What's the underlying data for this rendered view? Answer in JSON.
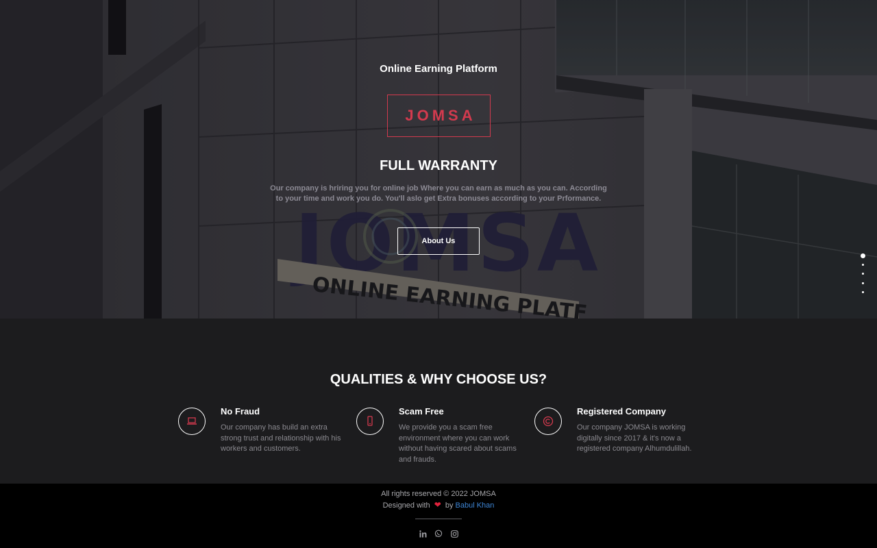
{
  "hero": {
    "kicker": "Online Earning Platform",
    "brand": "JOMSA",
    "title": "FULL WARRANTY",
    "description": "Our company is hriring you for online job Where you can earn as much as you can. According to your time and work you do. You'll aslo get Extra bonuses according to your Prformance.",
    "button_label": "About Us",
    "background_sign_text": "ONLINE EARNING PLATFORM",
    "background_logo_text": "JOMSA",
    "slider": {
      "count": 5,
      "active_index": 0
    }
  },
  "qualities": {
    "title": "QUALITIES & WHY CHOOSE US?",
    "items": [
      {
        "icon": "laptop-icon",
        "heading": "No Fraud",
        "text": "Our company has build an extra strong trust and relationship with his workers and customers."
      },
      {
        "icon": "mobile-icon",
        "heading": "Scam Free",
        "text": "We provide you a scam free environment where you can work without having scared about scams and frauds."
      },
      {
        "icon": "copyright-icon",
        "heading": "Registered Company",
        "text": "Our company JOMSA is working digitally since 2017 & it's now a registered company Alhumdulillah."
      }
    ]
  },
  "footer": {
    "rights": "All rights reserved © 2022 JOMSA",
    "designed_prefix": "Designed with",
    "heart": "❤",
    "designed_by": "by",
    "designer": "Babul Khan",
    "socials": [
      "linkedin-icon",
      "whatsapp-icon",
      "instagram-icon"
    ]
  },
  "colors": {
    "accent": "#d33a4e",
    "link": "#3e86d6",
    "section_bg": "#1c1c1e",
    "footer_bg": "#000000"
  }
}
